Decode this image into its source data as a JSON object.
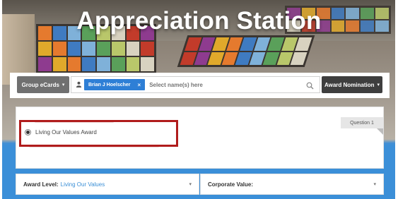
{
  "header": {
    "title": "Appreciation Station"
  },
  "toolbar": {
    "group_ecards_label": "Group eCards",
    "selected_recipient": "Brian J Hoelscher",
    "recipient_placeholder": "Select name(s) here",
    "award_nomination_label": "Award Nomination"
  },
  "question": {
    "tab_label": "Question 1",
    "selected_option": "Living Our Values Award"
  },
  "fields": {
    "award_level_label": "Award Level:",
    "award_level_value": "Living Our Values",
    "corporate_value_label": "Corporate Value:"
  },
  "colors": {
    "accent_blue": "#2e7fd6",
    "highlight_red": "#b01c1c",
    "dark_button": "#3e3e3e"
  }
}
